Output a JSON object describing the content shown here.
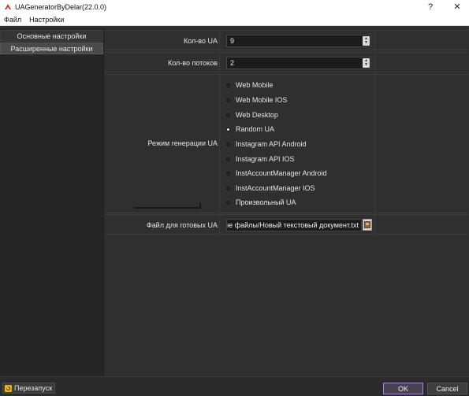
{
  "window": {
    "title": "UAGeneratorByDelar(22.0.0)",
    "help_label": "?",
    "close_label": "✕",
    "icon": "app-logo-icon"
  },
  "menu": {
    "items": [
      "Файл",
      "Настройки"
    ]
  },
  "nav": {
    "items": [
      {
        "label": "Основные настройки",
        "selected": false
      },
      {
        "label": "Расширенные настройки",
        "selected": true
      }
    ]
  },
  "settings": {
    "ua_count": {
      "label": "Кол-во UA",
      "value": "9"
    },
    "threads": {
      "label": "Кол-во потоков",
      "value": "2"
    },
    "mode": {
      "label": "Режим генерации UA",
      "selected": "Random UA",
      "options": [
        "Web Mobile",
        "Web Mobile IOS",
        "Web Desktop",
        "Random UA",
        "Instagram API Android",
        "Instagram API IOS",
        "InstAccountManager Android",
        "InstAccountManager IOS",
        "Произвольный UA"
      ]
    },
    "output_file": {
      "label": "Файл для готовых UA",
      "value": "ые файлы/Новый текстовый документ.txt",
      "browse_icon": "folder-browse-icon"
    }
  },
  "footer": {
    "restart_label": "Перезапуск",
    "restart_icon": "restart-icon",
    "ok_label": "OK",
    "cancel_label": "Cancel"
  },
  "colors": {
    "background": "#2f2f2f",
    "accent": "#a58bd6"
  }
}
